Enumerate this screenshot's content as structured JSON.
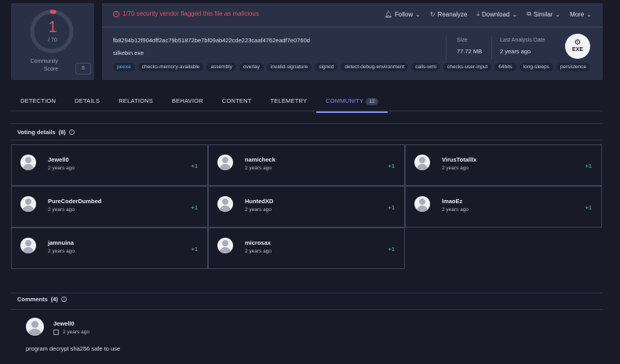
{
  "score": {
    "value": "1",
    "denominator": "/ 70",
    "community_label": "Community Score",
    "community_value": "8",
    "detection_ratio": 0.0143,
    "gauge_color": "#e05061"
  },
  "header": {
    "alert_text": "1/70 security vendor flagged this file as malicious",
    "actions": [
      {
        "label": "Follow",
        "icon": "bell-icon"
      },
      {
        "label": "Reanalyze",
        "icon": "refresh-icon"
      },
      {
        "label": "Download",
        "icon": "download-icon"
      },
      {
        "label": "Similar",
        "icon": "similar-icon"
      },
      {
        "label": "More",
        "icon": "chevron-down-icon"
      }
    ],
    "hash": "fb8294b12f904dff2ac79b51872be7bf09ab422cde223caaf4762eadf7e0760d",
    "filename": "silkebin.exe",
    "tags": [
      "peexe",
      "checks-memory-available",
      "assembly",
      "overlay",
      "invalid-signature",
      "signed",
      "detect-debug-environment",
      "calls-wmi",
      "checks-user-input",
      "64bits",
      "long-sleeps",
      "persistence"
    ],
    "size_label": "Size",
    "size_value": "77.72 MB",
    "date_label": "Last Analysis Date",
    "date_value": "2 years ago",
    "file_type": "EXE"
  },
  "tabs": [
    {
      "label": "DETECTION"
    },
    {
      "label": "DETAILS"
    },
    {
      "label": "RELATIONS"
    },
    {
      "label": "BEHAVIOR"
    },
    {
      "label": "CONTENT"
    },
    {
      "label": "TELEMETRY"
    },
    {
      "label": "COMMUNITY",
      "badge": "12",
      "active": true
    }
  ],
  "voting": {
    "title": "Voting details",
    "count": "(8)",
    "votes": [
      {
        "user": "Jewell0",
        "time": "2 years ago",
        "score": "+1"
      },
      {
        "user": "namicheck",
        "time": "2 years ago",
        "score": "+1"
      },
      {
        "user": "VirusTotalllx",
        "time": "2 years ago",
        "score": "+1"
      },
      {
        "user": "PureCoderDumbed",
        "time": "2 years ago",
        "score": "+1"
      },
      {
        "user": "HuntedXD",
        "time": "2 years ago",
        "score": "+1"
      },
      {
        "user": "lmaoEz",
        "time": "2 years ago",
        "score": "+1"
      },
      {
        "user": "jamnuina",
        "time": "2 years ago",
        "score": "+1"
      },
      {
        "user": "microsax",
        "time": "2 years ago",
        "score": "+1"
      }
    ]
  },
  "comments": {
    "title": "Comments",
    "count": "(4)",
    "items": [
      {
        "user": "Jewell0",
        "time": "2 years ago",
        "text": "program decrypt sha256 safe to use"
      }
    ]
  }
}
